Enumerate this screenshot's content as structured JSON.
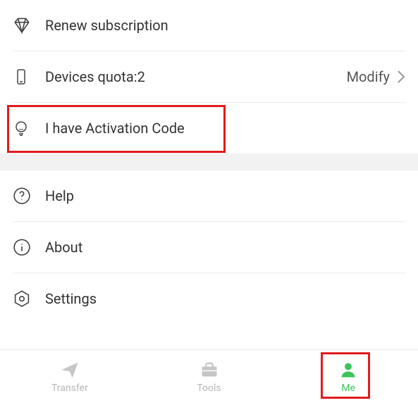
{
  "list": {
    "renew": {
      "label": "Renew subscription"
    },
    "devices": {
      "label": "Devices quota:2",
      "trail": "Modify"
    },
    "activation": {
      "label": "I have Activation Code"
    },
    "help": {
      "label": "Help"
    },
    "about": {
      "label": "About"
    },
    "settings": {
      "label": "Settings"
    }
  },
  "nav": {
    "transfer": {
      "label": "Transfer"
    },
    "tools": {
      "label": "Tools"
    },
    "me": {
      "label": "Me"
    }
  },
  "colors": {
    "accent": "#3cc35a",
    "highlight": "#e11b1b"
  }
}
